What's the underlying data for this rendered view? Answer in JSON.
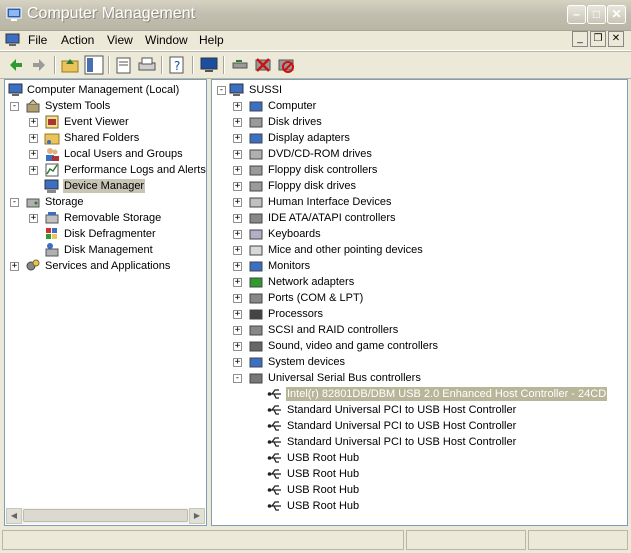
{
  "window": {
    "title": "Computer Management"
  },
  "menu": [
    "File",
    "Action",
    "View",
    "Window",
    "Help"
  ],
  "mdi_controls": [
    "minimize-icon",
    "restore-icon",
    "close-icon"
  ],
  "toolbar": [
    "back-arrow-icon",
    "forward-arrow-icon",
    "up-folder-icon",
    "show-hide-tree-icon",
    "properties-icon",
    "print-icon",
    "help-icon",
    "console-icon",
    "scan-hardware-icon",
    "uninstall-icon",
    "disable-icon"
  ],
  "tree": {
    "root": "Computer Management (Local)",
    "items": [
      {
        "label": "System Tools",
        "icon": "tools-icon"
      },
      {
        "label": "Event Viewer",
        "icon": "event-viewer-icon"
      },
      {
        "label": "Shared Folders",
        "icon": "shared-folders-icon"
      },
      {
        "label": "Local Users and Groups",
        "icon": "users-icon"
      },
      {
        "label": "Performance Logs and Alerts",
        "icon": "performance-icon"
      },
      {
        "label": "Device Manager",
        "icon": "device-manager-icon"
      },
      {
        "label": "Storage",
        "icon": "storage-icon"
      },
      {
        "label": "Removable Storage",
        "icon": "removable-storage-icon"
      },
      {
        "label": "Disk Defragmenter",
        "icon": "defrag-icon"
      },
      {
        "label": "Disk Management",
        "icon": "disk-management-icon"
      },
      {
        "label": "Services and Applications",
        "icon": "services-icon"
      }
    ]
  },
  "devices": {
    "root": "SUSSI",
    "categories": [
      "Computer",
      "Disk drives",
      "Display adapters",
      "DVD/CD-ROM drives",
      "Floppy disk controllers",
      "Floppy disk drives",
      "Human Interface Devices",
      "IDE ATA/ATAPI controllers",
      "Keyboards",
      "Mice and other pointing devices",
      "Monitors",
      "Network adapters",
      "Ports (COM & LPT)",
      "Processors",
      "SCSI and RAID controllers",
      "Sound, video and game controllers",
      "System devices",
      "Universal Serial Bus controllers"
    ],
    "usb_children": [
      "Intel(r) 82801DB/DBM USB 2.0 Enhanced Host Controller - 24CD",
      "Standard Universal PCI to USB Host Controller",
      "Standard Universal PCI to USB Host Controller",
      "Standard Universal PCI to USB Host Controller",
      "USB Root Hub",
      "USB Root Hub",
      "USB Root Hub",
      "USB Root Hub"
    ]
  }
}
